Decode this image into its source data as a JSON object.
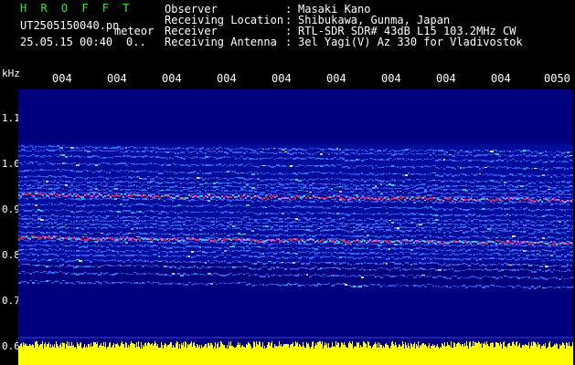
{
  "header": {
    "app_title": "H R O F F T",
    "file_name": "UT2505150040.pn",
    "mode": "meteor",
    "timestamp": "25.05.15 00:40",
    "timestamp_extra": "0..",
    "info": [
      {
        "key": "Observer",
        "value": "Masaki Kano"
      },
      {
        "key": "Receiving Location",
        "value": "Shibukawa, Gunma, Japan"
      },
      {
        "key": "Receiver",
        "value": "RTL-SDR SDR# 43dB L15 103.2MHz CW"
      },
      {
        "key": "Receiving Antenna",
        "value": "3el Yagi(V) Az 330 for Vladivostok"
      }
    ],
    "separator": ":"
  },
  "axis": {
    "unit": "kHz",
    "y_ticks": [
      "1.1",
      "1.0",
      "0.9",
      "0.8",
      "0.7",
      "0.6"
    ],
    "x_ticks": [
      "004",
      "004",
      "004",
      "004",
      "004",
      "004",
      "004",
      "004",
      "004",
      "0050"
    ]
  },
  "colors": {
    "background": "#000000",
    "plot_bg": "#00007e",
    "title_green": "#30e830",
    "signal_blue": "#3a6dff",
    "signal_cyan": "#40e0ff",
    "signal_red": "#ff3040",
    "amplitude_yellow": "#ffff00"
  }
}
